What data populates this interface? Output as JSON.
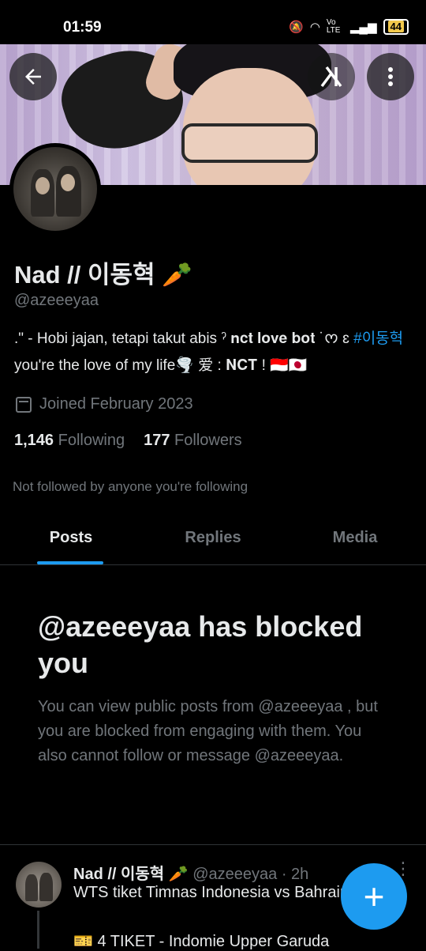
{
  "status_bar": {
    "time": "01:59",
    "signal_text": "Vo LTE",
    "battery": "44"
  },
  "header": {
    "back_icon": "arrow-left-icon",
    "logo_text": "x",
    "more_icon": "more-vertical-icon"
  },
  "profile": {
    "name": "Nad // 이동혁 🥕",
    "handle": "@azeeeyaa",
    "bio_part1": ".\" - Hobi jajan, tetapi takut abis ˀ 𝐧𝐜𝐭 𝐥𝐨𝐯𝐞 𝐛𝐨𝐭 ˙ᰔ ɛ ",
    "bio_hashtag": "#이동혁",
    "bio_part2": " you're the love of my life🌪️ 爱 : 𝐍𝐂𝐓 ! 🇮🇩🇯🇵",
    "joined": "Joined February 2023",
    "following_count": "1,146",
    "following_label": "Following",
    "followers_count": "177",
    "followers_label": "Followers",
    "not_followed": "Not followed by anyone you're following"
  },
  "tabs": [
    {
      "label": "Posts",
      "active": true
    },
    {
      "label": "Replies",
      "active": false
    },
    {
      "label": "Media",
      "active": false
    }
  ],
  "blocked": {
    "title": "@azeeeyaa has blocked you",
    "body": "You can view public posts from @azeeeyaa , but you are blocked from engaging with them. You also cannot follow or message @azeeeyaa."
  },
  "post": {
    "name": "Nad // 이동혁 🥕",
    "meta": "@azeeeyaa · 2h",
    "text": "WTS tiket Timnas Indonesia vs Bahrain",
    "text2": "🎫 4 TIKET - Indomie Upper Garuda"
  },
  "fab": {
    "label": "+"
  },
  "colors": {
    "accent": "#1d9bf0",
    "background": "#000000",
    "muted": "#71767b"
  }
}
